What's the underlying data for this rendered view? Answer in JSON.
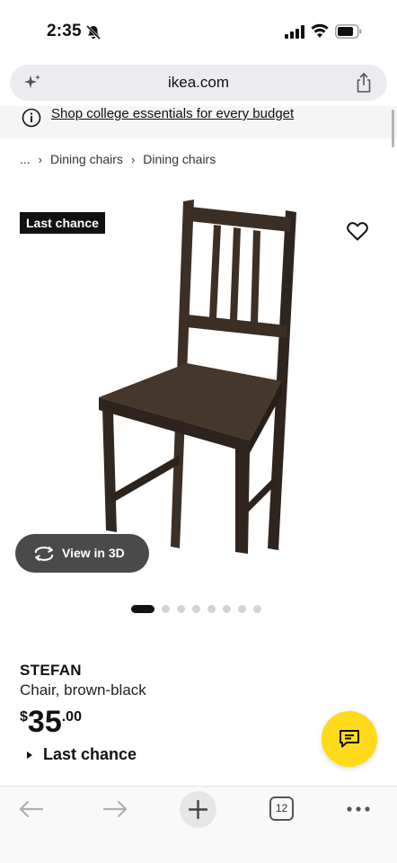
{
  "status_bar": {
    "time": "2:35"
  },
  "browser": {
    "url": "ikea.com",
    "tab_count": "12"
  },
  "promo": {
    "text": "Shop college essentials for every budget"
  },
  "breadcrumb": {
    "ellipsis": "...",
    "items": [
      "Dining chairs",
      "Dining chairs"
    ]
  },
  "product": {
    "badge": "Last chance",
    "view_3d_label": "View in 3D",
    "name": "STEFAN",
    "description": "Chair, brown-black",
    "price_currency": "$",
    "price_whole": "35",
    "price_cents": ".00",
    "availability_label": "Last chance",
    "image_count": 8,
    "active_image": 1
  },
  "colors": {
    "accent_yellow": "#ffda1a",
    "badge_bg": "#111111",
    "chair": "#3b2f26"
  },
  "icons": [
    "bell-slash-icon",
    "signal-icon",
    "wifi-icon",
    "battery-icon",
    "sparkle-icon",
    "share-icon",
    "info-icon",
    "heart-icon",
    "rotate-3d-icon",
    "chat-icon",
    "back-arrow-icon",
    "forward-arrow-icon",
    "plus-icon",
    "tabs-icon",
    "more-icon"
  ]
}
